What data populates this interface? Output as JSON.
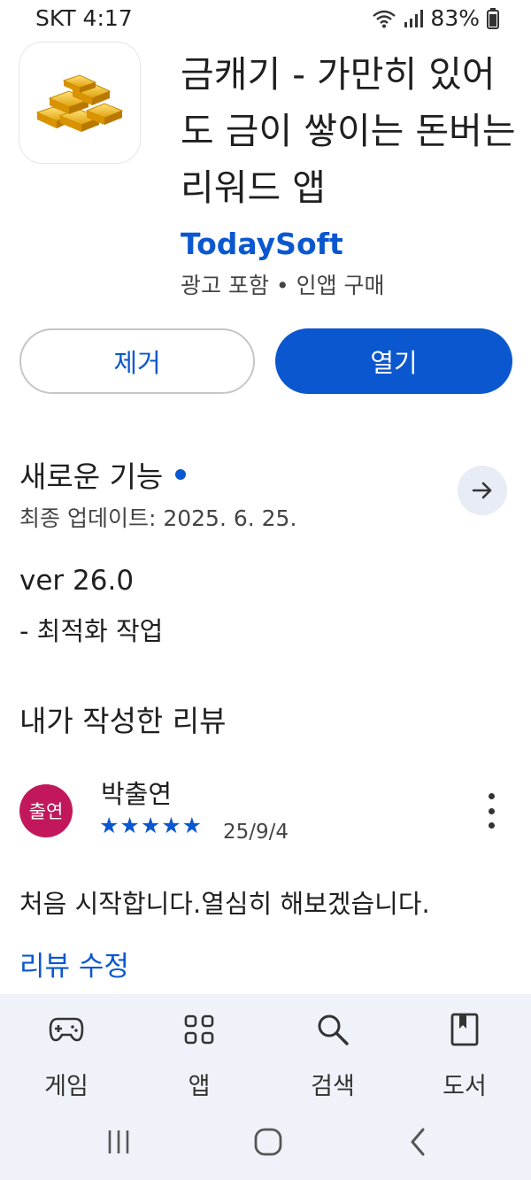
{
  "status": {
    "carrier_time": "SKT 4:17",
    "battery": "83%"
  },
  "app": {
    "title": "금캐기 - 가만히 있어도 금이 쌓이는 돈버는 리워드 앱",
    "developer": "TodaySoft",
    "meta": "광고 포함 • 인앱 구매",
    "icon": "gold-bars-icon"
  },
  "actions": {
    "remove_label": "제거",
    "open_label": "열기"
  },
  "whats_new": {
    "title": "새로운 기능",
    "updated": "최종 업데이트: 2025. 6. 25.",
    "line1": "ver 26.0",
    "line2": "- 최적화 작업"
  },
  "review": {
    "section_title": "내가 작성한 리뷰",
    "avatar_text": "출연",
    "reviewer": "박출연",
    "stars": "★★★★★",
    "rating": 5,
    "date": "25/9/4",
    "text": "처음 시작합니다.열심히 해보겠습니다.",
    "edit_label": "리뷰 수정"
  },
  "bottom_nav": [
    {
      "label": "게임",
      "icon": "gamepad-icon"
    },
    {
      "label": "앱",
      "icon": "apps-grid-icon"
    },
    {
      "label": "검색",
      "icon": "search-icon"
    },
    {
      "label": "도서",
      "icon": "book-icon"
    }
  ],
  "colors": {
    "accent": "#0b57d0",
    "avatar": "#c2185b",
    "nav_bg": "#eff3f9"
  }
}
